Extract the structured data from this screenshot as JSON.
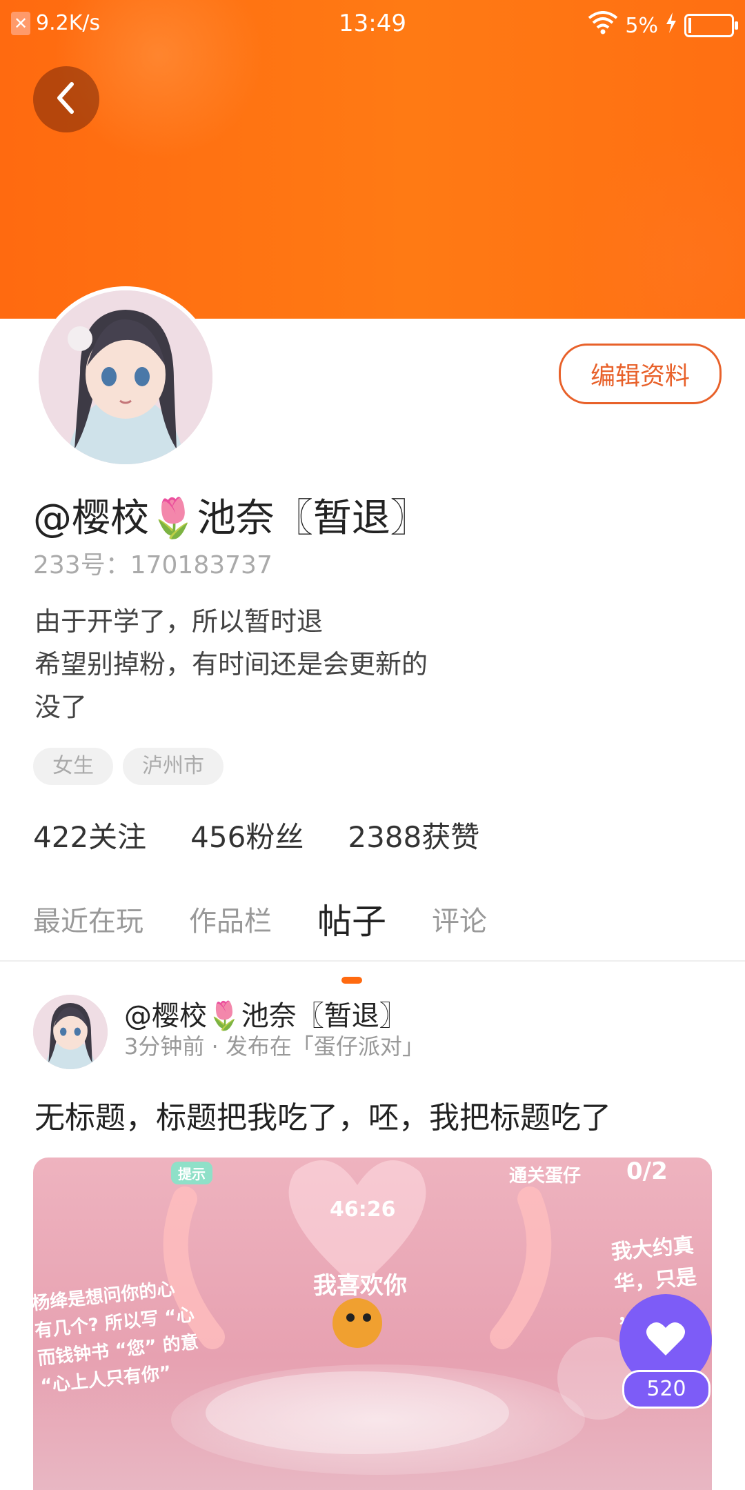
{
  "statusbar": {
    "net_speed": "9.2K/s",
    "time": "13:49",
    "battery_percent": "5%"
  },
  "profile": {
    "edit_label": "编辑资料",
    "username": "@樱校🌷池奈〖暂退〗",
    "uid": "233号：170183737",
    "bio": [
      "由于开学了，所以暂时退",
      "希望别掉粉，有时间还是会更新的",
      "没了"
    ],
    "tags": [
      "女生",
      "泸州市"
    ],
    "stats": {
      "following": "422关注",
      "followers": "456粉丝",
      "likes": "2388获赞"
    }
  },
  "tabs": [
    "最近在玩",
    "作品栏",
    "帖子",
    "评论"
  ],
  "active_tab": "帖子",
  "post": {
    "author": "@樱校🌷池奈〖暂退〗",
    "meta": "3分钟前 · 发布在「蛋仔派对」",
    "title": "无标题，标题把我吃了，呸，我把标题吃了",
    "image_texts": {
      "hint": "提示",
      "goal": "通关蛋仔",
      "goal_count": "0/2",
      "timer": "46:26",
      "center": "我喜欢你",
      "left_caption": "杨绛是想问你的心\n有几个? 所以写 “心\n而钱钟书 “您” 的意\n“心上人只有你”",
      "right_caption": "我大约真\n华，只是\n，于是"
    },
    "like_count": "520"
  },
  "colors": {
    "brand_orange": "#ff6a10",
    "accent_purple": "#7d5cf7",
    "edit_orange": "#e8612a"
  }
}
